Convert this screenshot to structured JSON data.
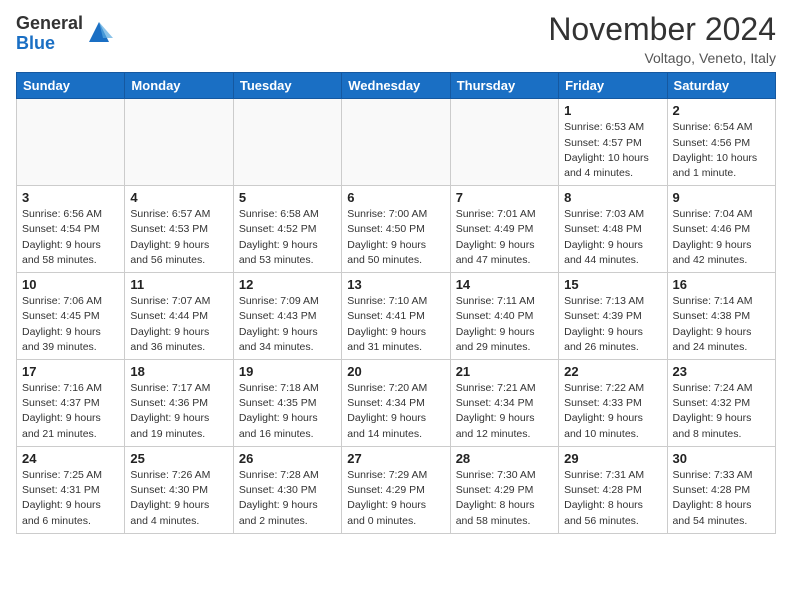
{
  "logo": {
    "line1": "General",
    "line2": "Blue"
  },
  "title": "November 2024",
  "location": "Voltago, Veneto, Italy",
  "weekdays": [
    "Sunday",
    "Monday",
    "Tuesday",
    "Wednesday",
    "Thursday",
    "Friday",
    "Saturday"
  ],
  "weeks": [
    [
      {
        "day": "",
        "info": ""
      },
      {
        "day": "",
        "info": ""
      },
      {
        "day": "",
        "info": ""
      },
      {
        "day": "",
        "info": ""
      },
      {
        "day": "",
        "info": ""
      },
      {
        "day": "1",
        "info": "Sunrise: 6:53 AM\nSunset: 4:57 PM\nDaylight: 10 hours\nand 4 minutes."
      },
      {
        "day": "2",
        "info": "Sunrise: 6:54 AM\nSunset: 4:56 PM\nDaylight: 10 hours\nand 1 minute."
      }
    ],
    [
      {
        "day": "3",
        "info": "Sunrise: 6:56 AM\nSunset: 4:54 PM\nDaylight: 9 hours\nand 58 minutes."
      },
      {
        "day": "4",
        "info": "Sunrise: 6:57 AM\nSunset: 4:53 PM\nDaylight: 9 hours\nand 56 minutes."
      },
      {
        "day": "5",
        "info": "Sunrise: 6:58 AM\nSunset: 4:52 PM\nDaylight: 9 hours\nand 53 minutes."
      },
      {
        "day": "6",
        "info": "Sunrise: 7:00 AM\nSunset: 4:50 PM\nDaylight: 9 hours\nand 50 minutes."
      },
      {
        "day": "7",
        "info": "Sunrise: 7:01 AM\nSunset: 4:49 PM\nDaylight: 9 hours\nand 47 minutes."
      },
      {
        "day": "8",
        "info": "Sunrise: 7:03 AM\nSunset: 4:48 PM\nDaylight: 9 hours\nand 44 minutes."
      },
      {
        "day": "9",
        "info": "Sunrise: 7:04 AM\nSunset: 4:46 PM\nDaylight: 9 hours\nand 42 minutes."
      }
    ],
    [
      {
        "day": "10",
        "info": "Sunrise: 7:06 AM\nSunset: 4:45 PM\nDaylight: 9 hours\nand 39 minutes."
      },
      {
        "day": "11",
        "info": "Sunrise: 7:07 AM\nSunset: 4:44 PM\nDaylight: 9 hours\nand 36 minutes."
      },
      {
        "day": "12",
        "info": "Sunrise: 7:09 AM\nSunset: 4:43 PM\nDaylight: 9 hours\nand 34 minutes."
      },
      {
        "day": "13",
        "info": "Sunrise: 7:10 AM\nSunset: 4:41 PM\nDaylight: 9 hours\nand 31 minutes."
      },
      {
        "day": "14",
        "info": "Sunrise: 7:11 AM\nSunset: 4:40 PM\nDaylight: 9 hours\nand 29 minutes."
      },
      {
        "day": "15",
        "info": "Sunrise: 7:13 AM\nSunset: 4:39 PM\nDaylight: 9 hours\nand 26 minutes."
      },
      {
        "day": "16",
        "info": "Sunrise: 7:14 AM\nSunset: 4:38 PM\nDaylight: 9 hours\nand 24 minutes."
      }
    ],
    [
      {
        "day": "17",
        "info": "Sunrise: 7:16 AM\nSunset: 4:37 PM\nDaylight: 9 hours\nand 21 minutes."
      },
      {
        "day": "18",
        "info": "Sunrise: 7:17 AM\nSunset: 4:36 PM\nDaylight: 9 hours\nand 19 minutes."
      },
      {
        "day": "19",
        "info": "Sunrise: 7:18 AM\nSunset: 4:35 PM\nDaylight: 9 hours\nand 16 minutes."
      },
      {
        "day": "20",
        "info": "Sunrise: 7:20 AM\nSunset: 4:34 PM\nDaylight: 9 hours\nand 14 minutes."
      },
      {
        "day": "21",
        "info": "Sunrise: 7:21 AM\nSunset: 4:34 PM\nDaylight: 9 hours\nand 12 minutes."
      },
      {
        "day": "22",
        "info": "Sunrise: 7:22 AM\nSunset: 4:33 PM\nDaylight: 9 hours\nand 10 minutes."
      },
      {
        "day": "23",
        "info": "Sunrise: 7:24 AM\nSunset: 4:32 PM\nDaylight: 9 hours\nand 8 minutes."
      }
    ],
    [
      {
        "day": "24",
        "info": "Sunrise: 7:25 AM\nSunset: 4:31 PM\nDaylight: 9 hours\nand 6 minutes."
      },
      {
        "day": "25",
        "info": "Sunrise: 7:26 AM\nSunset: 4:30 PM\nDaylight: 9 hours\nand 4 minutes."
      },
      {
        "day": "26",
        "info": "Sunrise: 7:28 AM\nSunset: 4:30 PM\nDaylight: 9 hours\nand 2 minutes."
      },
      {
        "day": "27",
        "info": "Sunrise: 7:29 AM\nSunset: 4:29 PM\nDaylight: 9 hours\nand 0 minutes."
      },
      {
        "day": "28",
        "info": "Sunrise: 7:30 AM\nSunset: 4:29 PM\nDaylight: 8 hours\nand 58 minutes."
      },
      {
        "day": "29",
        "info": "Sunrise: 7:31 AM\nSunset: 4:28 PM\nDaylight: 8 hours\nand 56 minutes."
      },
      {
        "day": "30",
        "info": "Sunrise: 7:33 AM\nSunset: 4:28 PM\nDaylight: 8 hours\nand 54 minutes."
      }
    ]
  ]
}
